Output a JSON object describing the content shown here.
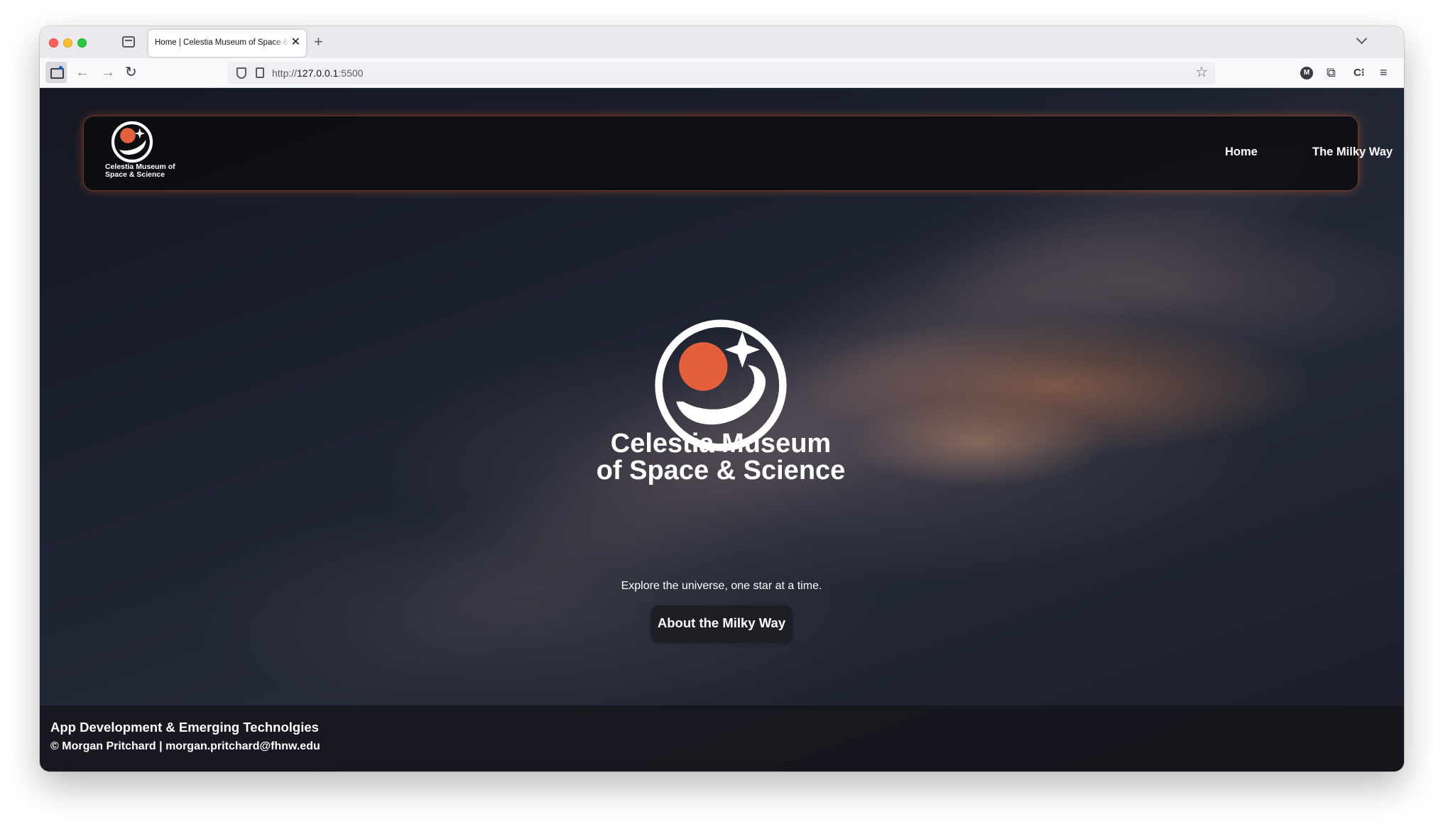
{
  "browser": {
    "tab_title": "Home | Celestia Museum of Space & Science",
    "tab_close": "✕",
    "new_tab": "+",
    "url_prefix": "http://",
    "url_host": "127.0.0.1",
    "url_port": ":5500",
    "back": "←",
    "forward": "→",
    "reload": "↻",
    "bookmark": "☆",
    "account_initial": "M",
    "puzzle": "⧉",
    "ext2": "C⁝",
    "menu": "≡"
  },
  "site": {
    "logo_text": "Celestia Museum of Space & Science",
    "nav": [
      {
        "label": "Home"
      },
      {
        "label": "The Milky Way"
      }
    ],
    "hero": {
      "title_line1": "Celestia Museum",
      "title_line2": "of Space & Science",
      "tagline": "Explore the universe, one star at a time.",
      "cta_label": "About the Milky Way"
    },
    "footer": {
      "course": "App Development & Emerging Technolgies",
      "credit": "© Morgan Pritchard | morgan.pritchard@fhnw.edu"
    }
  },
  "colors": {
    "planet_orange": "#e4603a",
    "header_glow": "#e66432",
    "page_bg": "#1c2130"
  },
  "icons": [
    "tab-list-icon",
    "sidebar-icon",
    "back-arrow-icon",
    "forward-arrow-icon",
    "reload-icon",
    "shield-icon",
    "page-icon",
    "star-bookmark-icon",
    "account-icon",
    "extensions-icon",
    "menu-icon",
    "museum-logo-icon"
  ]
}
